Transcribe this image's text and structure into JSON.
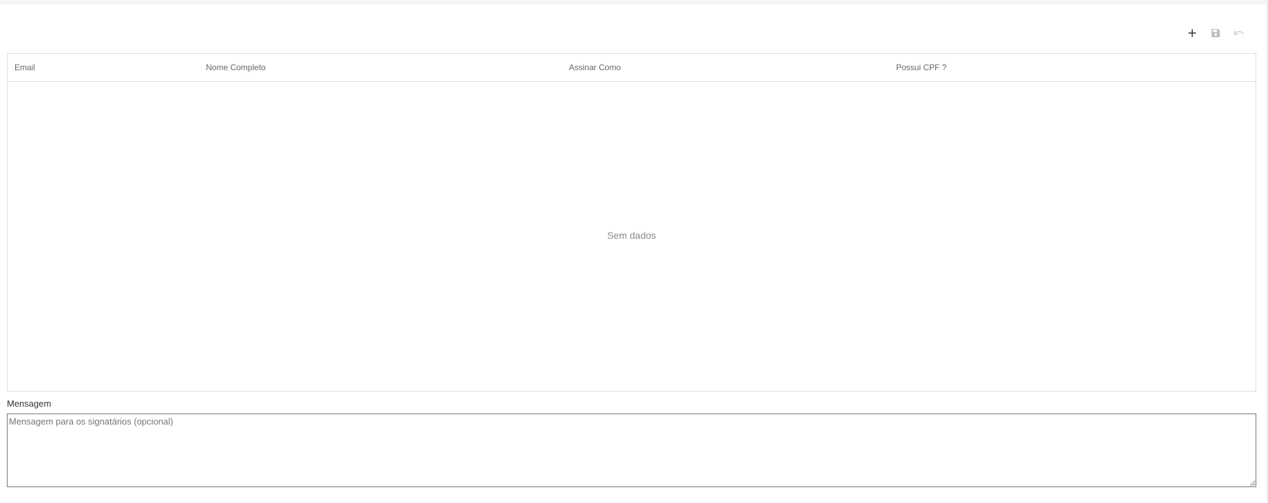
{
  "toolbar": {
    "add_icon": "plus-icon",
    "save_icon": "save-icon",
    "revert_icon": "undo-icon",
    "colors": {
      "add": "#333333",
      "save": "#bdbdbd",
      "revert": "#cfcfcf"
    }
  },
  "grid": {
    "columns": [
      "Email",
      "Nome Completo",
      "Assinar Como",
      "Possui CPF ?"
    ],
    "rows": [],
    "no_data_text": "Sem dados"
  },
  "message": {
    "label": "Mensagem",
    "value": "",
    "placeholder": "Mensagem para os signatários (opcional)"
  }
}
